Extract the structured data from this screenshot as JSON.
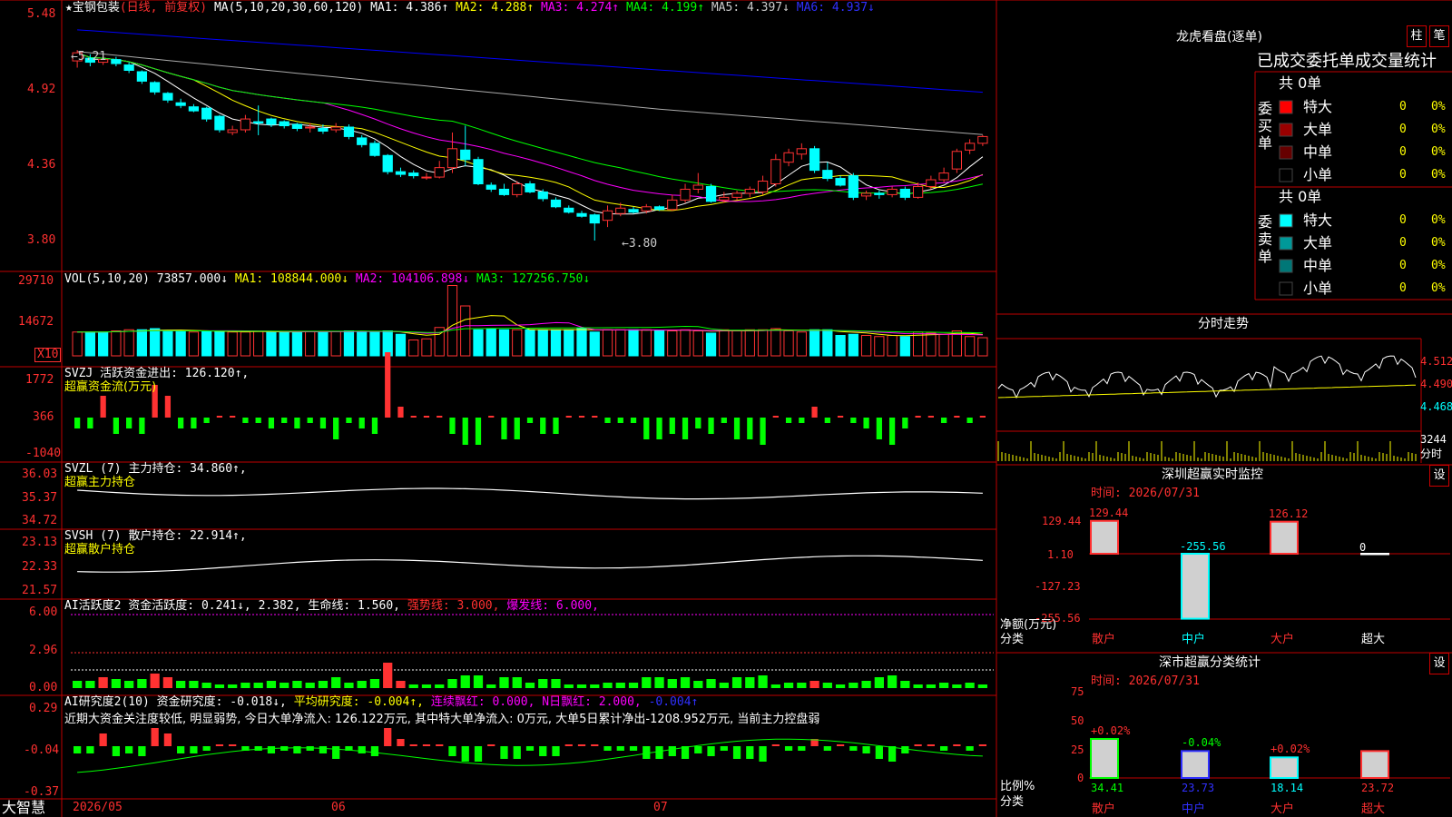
{
  "header": {
    "stock": "★宝钢包装",
    "mode": "(日线, 前复权)",
    "ma_label": "MA(5,10,20,30,60,120)",
    "ma1": "MA1: 4.386↑",
    "ma2": "MA2: 4.288↑",
    "ma3": "MA3: 4.274↑",
    "ma4": "MA4: 4.199↑",
    "ma5": "MA5: 4.397↓",
    "ma6": "MA6: 4.937↓"
  },
  "price_axis": [
    "5.48",
    "4.92",
    "4.36",
    "3.80"
  ],
  "price_annotations": {
    "high": "←5.21",
    "low": "←3.80"
  },
  "vol_panel": {
    "label": "VOL(5,10,20)",
    "value": "73857.000↓",
    "ma1": "MA1: 108844.000↓",
    "ma2": "MA2: 104106.898↓",
    "ma3": "MA3: 127256.750↓",
    "axis": [
      "29710",
      "14672"
    ],
    "unit": "X10"
  },
  "svzj_panel": {
    "line1": "SVZJ  活跃资金进出: 126.120↑,",
    "line2": "超赢资金流(万元)",
    "axis": [
      "1772",
      "366",
      "-1040"
    ]
  },
  "svzl_panel": {
    "line1": "SVZL (7) 主力持仓: 34.860↑,",
    "line2": "超赢主力持仓",
    "axis": [
      "36.03",
      "35.37",
      "34.72"
    ]
  },
  "svsh_panel": {
    "line1": "SVSH (7) 散户持仓: 22.914↑,",
    "line2": "超赢散户持仓",
    "axis": [
      "23.13",
      "22.33",
      "21.57"
    ]
  },
  "ai1_panel": {
    "label": "AI活跃度2 资金活跃度: 0.241↓,",
    "v2": "2.382,",
    "life": "生命线: 1.560,",
    "strong": "强势线: 3.000,",
    "burst": "爆发线: 6.000,",
    "axis": [
      "6.00",
      "2.96",
      "0.00"
    ]
  },
  "ai2_panel": {
    "label": "AI研究度2(10) 资金研究度: -0.018↓,",
    "avg": "平均研究度: -0.004↑,",
    "red1": "连续飘红: 0.000,",
    "red2": "N日飘红: 2.000,",
    "v5": "-0.004↑",
    "comment": "近期大资金关注度较低, 明显弱势, 今日大单净流入: 126.122万元, 其中特大单净流入: 0万元, 大单5日累计净出-1208.952万元, 当前主力控盘弱",
    "axis": [
      "0.29",
      "-0.04",
      "-0.37"
    ]
  },
  "footer": {
    "brand": "大智慧",
    "dates": [
      "2026/05",
      "06",
      "07"
    ]
  },
  "right": {
    "longhu_title": "龙虎看盘(逐单)",
    "btn_column": "柱",
    "btn_stroke": "笔",
    "stats_header": "已成交委托单成交量统计",
    "buy_side": "委买单",
    "sell_side": "委卖单",
    "buy_total": "共 0单",
    "sell_total": "共 0单",
    "buy_rows": [
      {
        "name": "特大",
        "val": "0",
        "pct": "0%",
        "color": "#ff0000"
      },
      {
        "name": "大单",
        "val": "0",
        "pct": "0%",
        "color": "#990000"
      },
      {
        "name": "中单",
        "val": "0",
        "pct": "0%",
        "color": "#660000"
      },
      {
        "name": "小单",
        "val": "0",
        "pct": "0%",
        "color": "#000000"
      }
    ],
    "sell_rows": [
      {
        "name": "特大",
        "val": "0",
        "pct": "0%",
        "color": "#00ffff"
      },
      {
        "name": "大单",
        "val": "0",
        "pct": "0%",
        "color": "#009999"
      },
      {
        "name": "中单",
        "val": "0",
        "pct": "0%",
        "color": "#007777"
      },
      {
        "name": "小单",
        "val": "0",
        "pct": "0%",
        "color": "#000000"
      }
    ],
    "intraday_title": "分时走势",
    "intraday_axis": [
      "4.512",
      "4.490",
      "4.468"
    ],
    "intraday_vol": [
      "3244",
      "分时"
    ],
    "monitor_title": "深圳超赢实时监控",
    "settings_btn": "设",
    "monitor_time": "时间: 2026/07/31",
    "monitor_axis": [
      "129.44",
      "1.10",
      "-127.23",
      "-255.56"
    ],
    "monitor_unit": "净额(万元)",
    "monitor_cat": "分类",
    "categories": [
      "散户",
      "中户",
      "大户",
      "超大"
    ],
    "class_title": "深市超赢分类统计",
    "class_time": "时间: 2026/07/31",
    "class_axis": [
      "75",
      "50",
      "25",
      "0"
    ],
    "class_unit": "比例%",
    "class_cat": "分类"
  },
  "chart_data": [
    {
      "type": "candlestick",
      "title": "宝钢包装 日线",
      "ylim": [
        3.8,
        5.48
      ],
      "candles": [
        [
          5.13,
          5.19,
          5.08,
          5.21
        ],
        [
          5.15,
          5.12,
          5.09,
          5.18
        ],
        [
          5.12,
          5.14,
          5.1,
          5.17
        ],
        [
          5.14,
          5.11,
          5.09,
          5.16
        ],
        [
          5.1,
          5.06,
          5.04,
          5.12
        ],
        [
          5.05,
          4.98,
          4.96,
          5.06
        ],
        [
          4.97,
          4.9,
          4.88,
          4.98
        ],
        [
          4.89,
          4.84,
          4.82,
          4.9
        ],
        [
          4.82,
          4.8,
          4.78,
          4.85
        ],
        [
          4.79,
          4.76,
          4.75,
          4.81
        ],
        [
          4.78,
          4.7,
          4.68,
          4.79
        ],
        [
          4.72,
          4.62,
          4.6,
          4.73
        ],
        [
          4.6,
          4.62,
          4.58,
          4.65
        ],
        [
          4.62,
          4.7,
          4.6,
          4.73
        ],
        [
          4.68,
          4.67,
          4.58,
          4.8
        ],
        [
          4.7,
          4.66,
          4.64,
          4.71
        ],
        [
          4.68,
          4.65,
          4.63,
          4.69
        ],
        [
          4.66,
          4.63,
          4.61,
          4.67
        ],
        [
          4.64,
          4.64,
          4.6,
          4.67
        ],
        [
          4.63,
          4.61,
          4.59,
          4.66
        ],
        [
          4.62,
          4.64,
          4.6,
          4.67
        ],
        [
          4.64,
          4.57,
          4.55,
          4.66
        ],
        [
          4.56,
          4.51,
          4.49,
          4.58
        ],
        [
          4.52,
          4.43,
          4.42,
          4.54
        ],
        [
          4.43,
          4.31,
          4.29,
          4.44
        ],
        [
          4.31,
          4.29,
          4.27,
          4.34
        ],
        [
          4.3,
          4.28,
          4.26,
          4.32
        ],
        [
          4.27,
          4.27,
          4.25,
          4.3
        ],
        [
          4.27,
          4.34,
          4.26,
          4.39
        ],
        [
          4.34,
          4.48,
          4.3,
          4.6
        ],
        [
          4.47,
          4.4,
          4.35,
          4.65
        ],
        [
          4.4,
          4.22,
          4.21,
          4.42
        ],
        [
          4.21,
          4.18,
          4.16,
          4.23
        ],
        [
          4.18,
          4.14,
          4.13,
          4.22
        ],
        [
          4.14,
          4.22,
          4.12,
          4.24
        ],
        [
          4.22,
          4.16,
          4.15,
          4.24
        ],
        [
          4.16,
          4.11,
          4.09,
          4.18
        ],
        [
          4.1,
          4.05,
          4.04,
          4.12
        ],
        [
          4.04,
          4.01,
          4.0,
          4.06
        ],
        [
          4.0,
          3.98,
          3.97,
          4.02
        ],
        [
          3.99,
          3.93,
          3.8,
          4.0
        ],
        [
          3.95,
          4.02,
          3.9,
          4.06
        ],
        [
          4.0,
          4.04,
          3.98,
          4.08
        ],
        [
          4.03,
          4.01,
          4.0,
          4.05
        ],
        [
          4.02,
          4.05,
          4.0,
          4.07
        ],
        [
          4.05,
          4.03,
          4.02,
          4.06
        ],
        [
          4.03,
          4.1,
          4.02,
          4.14
        ],
        [
          4.1,
          4.18,
          4.08,
          4.22
        ],
        [
          4.18,
          4.21,
          4.15,
          4.3
        ],
        [
          4.2,
          4.09,
          4.08,
          4.22
        ],
        [
          4.1,
          4.12,
          4.08,
          4.16
        ],
        [
          4.12,
          4.15,
          4.1,
          4.17
        ],
        [
          4.15,
          4.18,
          4.12,
          4.2
        ],
        [
          4.16,
          4.24,
          4.14,
          4.28
        ],
        [
          4.22,
          4.4,
          4.2,
          4.44
        ],
        [
          4.38,
          4.45,
          4.35,
          4.48
        ],
        [
          4.44,
          4.48,
          4.4,
          4.52
        ],
        [
          4.48,
          4.32,
          4.3,
          4.5
        ],
        [
          4.32,
          4.26,
          4.24,
          4.38
        ],
        [
          4.26,
          4.21,
          4.2,
          4.28
        ],
        [
          4.28,
          4.12,
          4.1,
          4.3
        ],
        [
          4.13,
          4.15,
          4.1,
          4.17
        ],
        [
          4.15,
          4.14,
          4.11,
          4.17
        ],
        [
          4.14,
          4.18,
          4.12,
          4.2
        ],
        [
          4.18,
          4.12,
          4.1,
          4.2
        ],
        [
          4.12,
          4.2,
          4.11,
          4.23
        ],
        [
          4.2,
          4.25,
          4.18,
          4.28
        ],
        [
          4.25,
          4.3,
          4.23,
          4.34
        ],
        [
          4.33,
          4.46,
          4.3,
          4.48
        ],
        [
          4.47,
          4.52,
          4.44,
          4.55
        ],
        [
          4.52,
          4.57,
          4.5,
          4.58
        ]
      ],
      "ma_colors": [
        "#ffffff",
        "#ffff00",
        "#ff00ff",
        "#00ff00",
        "#aaaaaa",
        "#0000ff"
      ]
    },
    {
      "type": "bar",
      "title": "VOL(5,10,20)",
      "ylim": [
        0,
        32000
      ],
      "values": [
        10500,
        10500,
        10500,
        11000,
        11500,
        11500,
        12000,
        11000,
        11000,
        10500,
        10800,
        10800,
        10500,
        10500,
        10800,
        10500,
        10500,
        10500,
        10800,
        10800,
        10800,
        11000,
        10800,
        10500,
        11000,
        9500,
        7000,
        7500,
        12500,
        31000,
        22000,
        11500,
        11800,
        11500,
        11500,
        11500,
        11500,
        11500,
        11500,
        12000,
        10500,
        11500,
        11500,
        11500,
        11500,
        11000,
        11000,
        11500,
        11000,
        10000,
        11500,
        11000,
        11500,
        11500,
        12000,
        11000,
        10500,
        11500,
        11500,
        9000,
        9500,
        9000,
        8500,
        9000,
        8500,
        10500,
        10000,
        9500,
        11000,
        8500,
        8000
      ],
      "up": [
        1,
        0,
        0,
        1,
        1,
        0,
        0,
        0,
        0,
        1,
        0,
        0,
        1,
        1,
        1,
        0,
        0,
        0,
        1,
        0,
        1,
        0,
        0,
        0,
        0,
        0,
        1,
        1,
        1,
        1,
        1,
        0,
        0,
        0,
        1,
        0,
        0,
        0,
        0,
        0,
        0,
        1,
        1,
        0,
        1,
        0,
        1,
        1,
        1,
        0,
        1,
        1,
        1,
        1,
        1,
        1,
        1,
        0,
        0,
        0,
        0,
        1,
        1,
        1,
        0,
        1,
        1,
        1,
        1,
        1,
        1
      ],
      "ma_colors": [
        "#ffff00",
        "#ff00ff",
        "#00ff00"
      ]
    }
  ]
}
